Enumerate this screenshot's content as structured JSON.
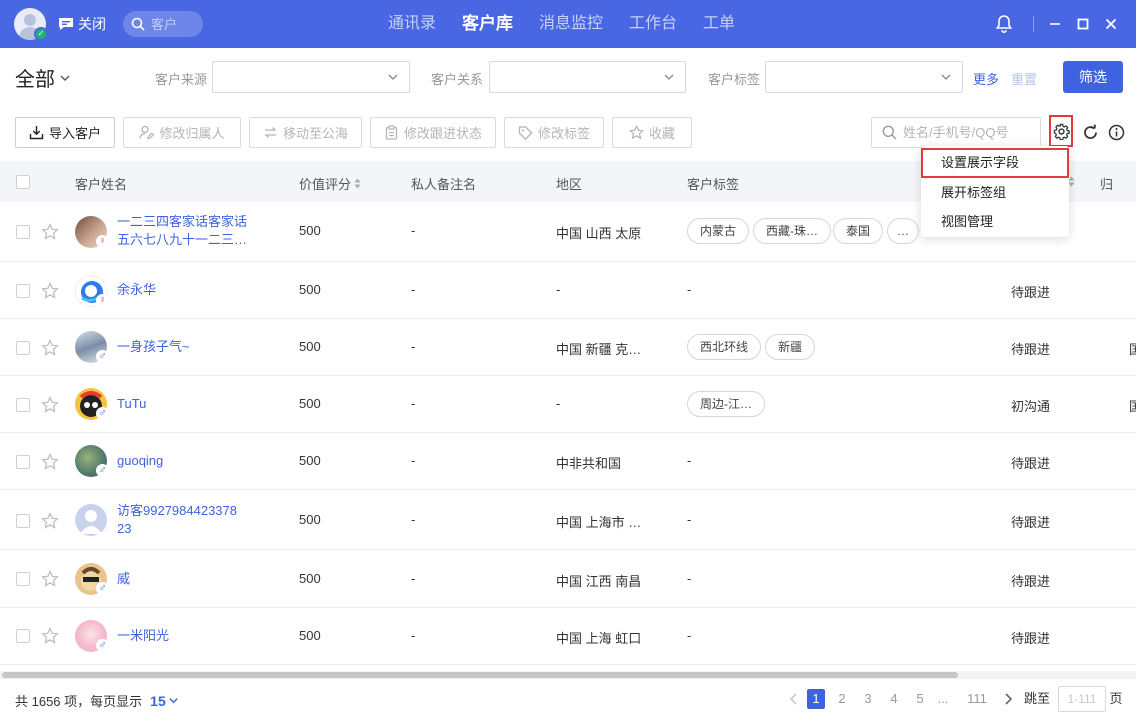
{
  "colors": {
    "brand": "#4a67e3",
    "link": "#3f63e0",
    "highlight": "#e23b3b",
    "female": "#ef4c72",
    "male": "#3f74e6"
  },
  "topbar": {
    "close_label": "关闭",
    "search_placeholder": "客户",
    "tabs": [
      {
        "label": "通讯录",
        "active": false
      },
      {
        "label": "客户库",
        "active": true
      },
      {
        "label": "消息监控",
        "active": false
      },
      {
        "label": "工作台",
        "active": false
      },
      {
        "label": "工单",
        "active": false
      }
    ],
    "icons": [
      "bell-icon",
      "minimize-icon",
      "maximize-icon",
      "close-icon"
    ]
  },
  "filters": {
    "scope": "全部",
    "source_label": "客户来源",
    "relation_label": "客户关系",
    "tag_label": "客户标签",
    "more": "更多",
    "reset": "重置",
    "submit": "筛选"
  },
  "toolbar": {
    "import": "导入客户",
    "change_owner": "修改归属人",
    "move_pool": "移动至公海",
    "change_status": "修改跟进状态",
    "change_tags": "修改标签",
    "favorite": "收藏",
    "search_placeholder": "姓名/手机号/QQ号"
  },
  "columns": {
    "name": "客户姓名",
    "score": "价值评分",
    "remark": "私人备注名",
    "region": "地区",
    "tags": "客户标签",
    "cut_off": "归"
  },
  "menu": {
    "items": [
      "设置展示字段",
      "展开标签组",
      "视图管理"
    ]
  },
  "rows": [
    {
      "name1": "一二三四客家话客家话",
      "name2": "五六七八九十一二三…",
      "gender": "♀",
      "score": "500",
      "remark": "-",
      "region": "中国 山西 太原",
      "tags": [
        "内蒙古",
        "西藏-珠…",
        "泰国",
        "…"
      ],
      "status": "",
      "edge": ""
    },
    {
      "name1": "余永华",
      "name2": "",
      "gender": "♀",
      "score": "500",
      "remark": "-",
      "region": "-",
      "tags": [
        "-"
      ],
      "status": "待跟进",
      "edge": ""
    },
    {
      "name1": "一身孩子气~",
      "name2": "",
      "gender": "♂",
      "score": "500",
      "remark": "-",
      "region": "中国 新疆 克…",
      "tags": [
        "西北环线",
        "新疆"
      ],
      "status": "待跟进",
      "edge": "国"
    },
    {
      "name1": "TuTu",
      "name2": "",
      "gender": "♂",
      "score": "500",
      "remark": "-",
      "region": "-",
      "tags": [
        "周边-江…"
      ],
      "status": "初沟通",
      "edge": "国"
    },
    {
      "name1": "guoqing",
      "name2": "",
      "gender": "♂",
      "score": "500",
      "remark": "-",
      "region": "中非共和国",
      "tags": [
        "-"
      ],
      "status": "待跟进",
      "edge": ""
    },
    {
      "name1": "访客9927984423378",
      "name2": "23",
      "gender": "",
      "score": "500",
      "remark": "-",
      "region": "中国 上海市 …",
      "tags": [
        "-"
      ],
      "status": "待跟进",
      "edge": ""
    },
    {
      "name1": "威",
      "name2": "",
      "gender": "♂",
      "score": "500",
      "remark": "-",
      "region": "中国 江西 南昌",
      "tags": [
        "-"
      ],
      "status": "待跟进",
      "edge": ""
    },
    {
      "name1": "一米阳光",
      "name2": "",
      "gender": "♂",
      "score": "500",
      "remark": "-",
      "region": "中国 上海 虹口",
      "tags": [
        "-"
      ],
      "status": "待跟进",
      "edge": ""
    }
  ],
  "footer": {
    "total_text": "共 1656 项，每页显示",
    "page_size": "15",
    "pages": [
      "1",
      "2",
      "3",
      "4",
      "5",
      "...",
      "111"
    ],
    "current_page": "1",
    "jump_label": "跳至",
    "jump_placeholder": "1-111",
    "page_unit": "页"
  }
}
